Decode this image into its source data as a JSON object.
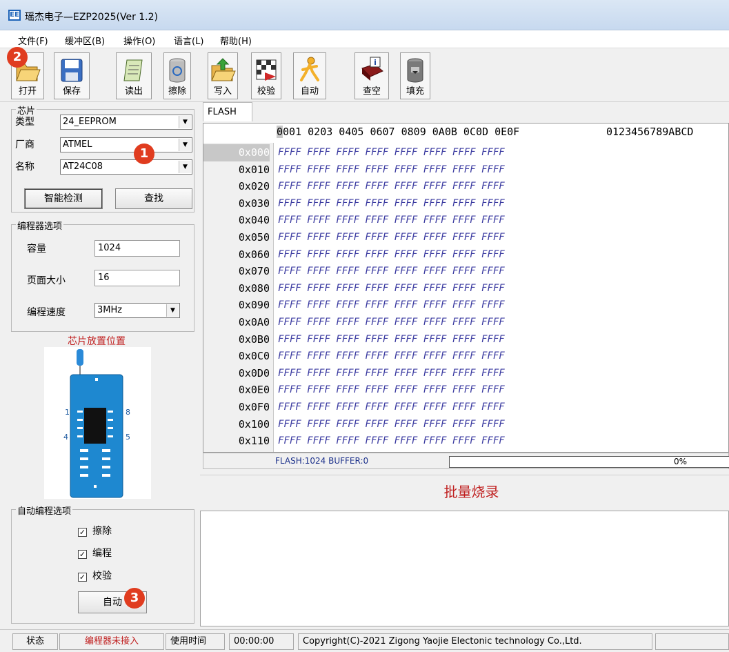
{
  "window": {
    "title": "瑶杰电子—EZP2025(Ver 1.2)",
    "icon_text": "EE"
  },
  "menu": [
    "文件(F)",
    "缓冲区(B)",
    "操作(O)",
    "语言(L)",
    "帮助(H)"
  ],
  "toolbar": [
    {
      "label": "打开",
      "icon": "folder-open-icon"
    },
    {
      "label": "保存",
      "icon": "floppy-disk-icon"
    },
    {
      "label": "读出",
      "icon": "notepad-read-icon"
    },
    {
      "label": "擦除",
      "icon": "erase-bin-icon"
    },
    {
      "label": "写入",
      "icon": "folder-write-icon"
    },
    {
      "label": "校验",
      "icon": "verify-checker-icon"
    },
    {
      "label": "自动",
      "icon": "runner-auto-icon"
    },
    {
      "label": "查空",
      "icon": "book-info-icon"
    },
    {
      "label": "填充",
      "icon": "bucket-fill-icon"
    }
  ],
  "chip": {
    "group_title": "芯片",
    "type_label": "类型",
    "type_value": "24_EEPROM",
    "vendor_label": "厂商",
    "vendor_value": "ATMEL",
    "name_label": "名称",
    "name_value": "AT24C08",
    "detect_button": "智能检测",
    "search_button": "查找"
  },
  "programmer": {
    "group_title": "编程器选项",
    "capacity_label": "容量",
    "capacity_value": "1024",
    "page_label": "页面大小",
    "page_value": "16",
    "speed_label": "编程速度",
    "speed_value": "3MHz"
  },
  "chip_position": {
    "title": "芯片放置位置",
    "pin1": "1",
    "pin4": "4",
    "pin8": "8",
    "pin5": "5"
  },
  "auto": {
    "group_title": "自动编程选项",
    "erase": "擦除",
    "program": "编程",
    "verify": "校验",
    "checkmark": "✓",
    "auto_button": "自动"
  },
  "badges": [
    "1",
    "2",
    "3"
  ],
  "tab": "FLASH",
  "hex": {
    "header_cur": "0",
    "header": "001 0203 0405 0607 0809 0A0B 0C0D 0E0F",
    "ascii_header": "0123456789ABCD",
    "addresses": [
      "0x000",
      "0x010",
      "0x020",
      "0x030",
      "0x040",
      "0x050",
      "0x060",
      "0x070",
      "0x080",
      "0x090",
      "0x0A0",
      "0x0B0",
      "0x0C0",
      "0x0D0",
      "0x0E0",
      "0x0F0",
      "0x100",
      "0x110"
    ],
    "row_value": "FFFF FFFF FFFF FFFF FFFF FFFF FFFF FFFF"
  },
  "status_strip": {
    "flash_info": "FLASH:1024 BUFFER:0",
    "progress_text": "0%",
    "progress": 0
  },
  "batch_label": "批量烧录",
  "statusbar": {
    "state_label": "状态",
    "state_value": "编程器未接入",
    "time_label": "使用时间",
    "time_value": "00:00:00",
    "copyright": "Copyright(C)-2021 Zigong Yaojie Electonic technology Co.,Ltd."
  },
  "colors": {
    "badge": "#e03c1f",
    "hex_text": "#3a3aa0",
    "warning_text": "#c02020",
    "chip_blue": "#1e88d0"
  }
}
